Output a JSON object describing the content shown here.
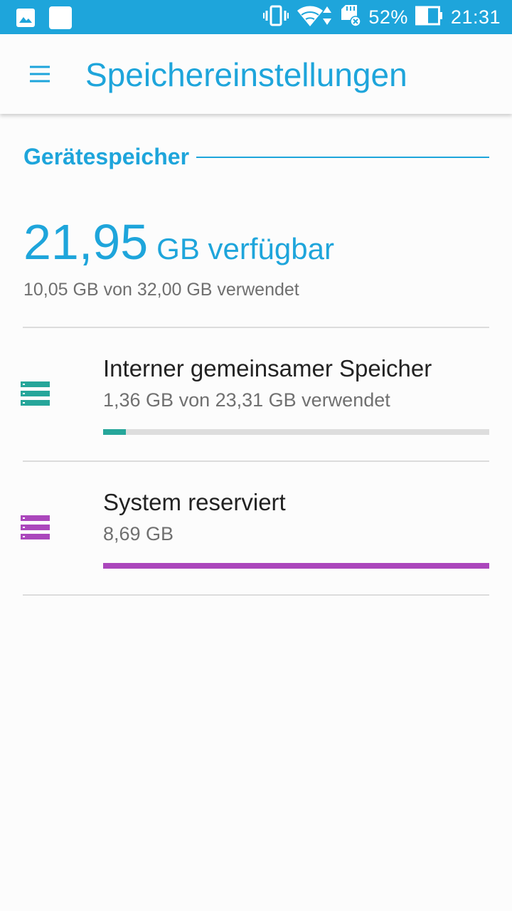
{
  "status_bar": {
    "battery_percent": "52%",
    "time": "21:31",
    "icons": [
      "image-notification-icon",
      "square-notification-icon",
      "vibrate-icon",
      "wifi-icon",
      "sd-card-icon",
      "battery-icon"
    ]
  },
  "app_bar": {
    "menu_icon": "hamburger-menu-icon",
    "title": "Speichereinstellungen"
  },
  "device_storage": {
    "section_title": "Gerätespeicher",
    "available_number": "21,95",
    "available_unit": "GB verfügbar",
    "used_summary": "10,05  GB von 32,00  GB verwendet"
  },
  "storage_items": [
    {
      "title": "Interner gemeinsamer Speicher",
      "subtitle": "1,36  GB von 23,31  GB verwendet",
      "fraction_used": 0.0583,
      "color": "#26a69a",
      "icon": "storage-list-icon"
    },
    {
      "title": "System reserviert",
      "subtitle": "8,69  GB",
      "fraction_used": 1.0,
      "color": "#ab47bc",
      "icon": "storage-list-icon"
    }
  ],
  "colors": {
    "accent": "#1ea5db",
    "status_bar": "#1ea5db",
    "divider": "#dcdcdc"
  }
}
